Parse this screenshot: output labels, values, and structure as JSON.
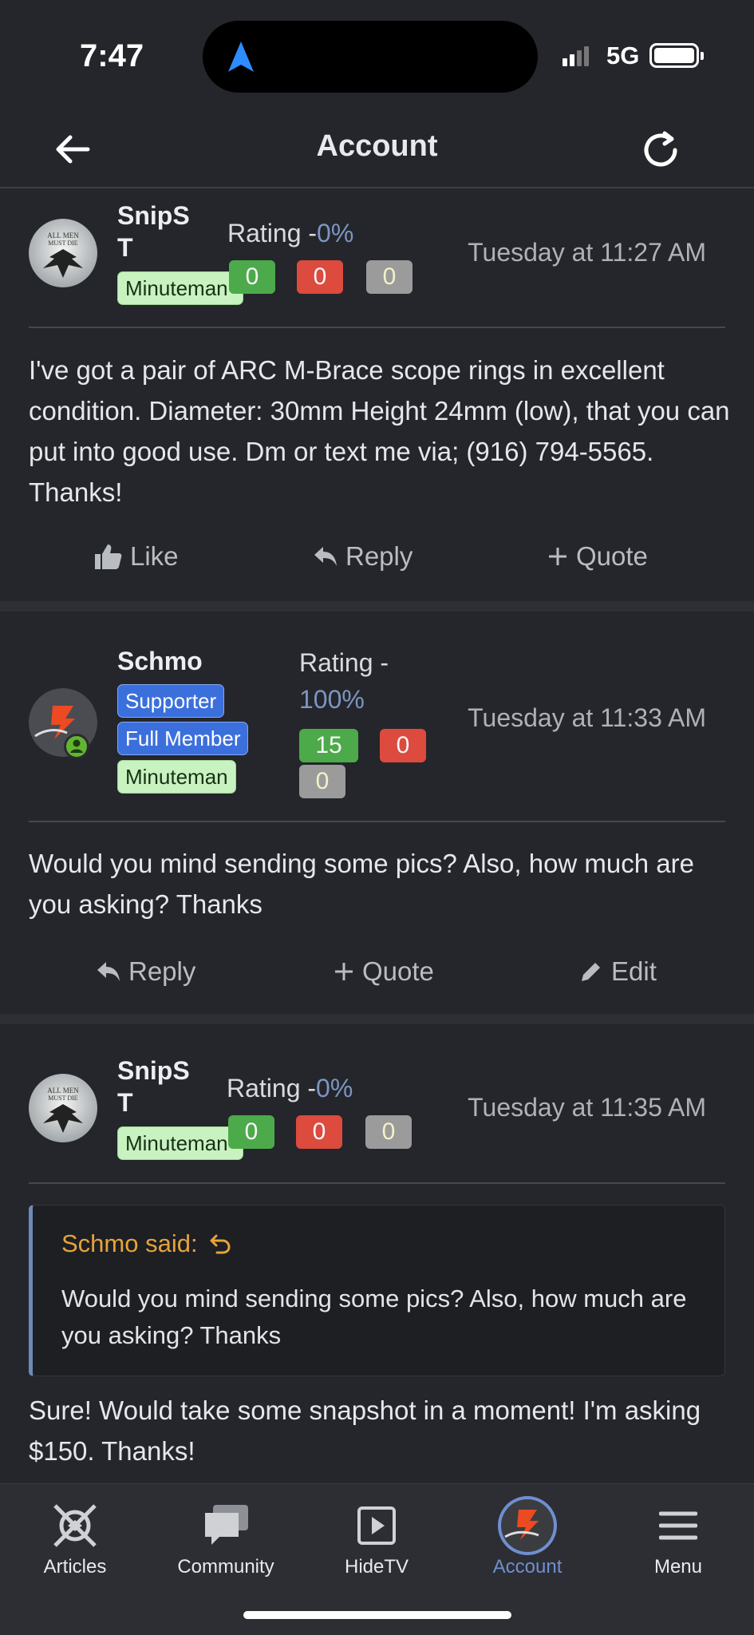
{
  "status_bar": {
    "time": "7:47",
    "network": "5G"
  },
  "header": {
    "title": "Account"
  },
  "posts": [
    {
      "username_line1": "SnipS",
      "username_line2": "T",
      "badges": [
        "Minuteman"
      ],
      "rating_label": "Rating -",
      "rating_pct": "0%",
      "likes": "0",
      "dislikes": "0",
      "neutral": "0",
      "date": "Tuesday at 11:27 AM",
      "body": "I've got a pair of ARC M-Brace scope rings in excellent condition. Diameter: 30mm Height 24mm (low), that you can put into good use. Dm or text me via; (916) 794-5565. Thanks!",
      "actions": [
        "Like",
        "Reply",
        "Quote"
      ]
    },
    {
      "username": "Schmo",
      "badges": [
        "Supporter",
        "Full Member",
        "Minuteman"
      ],
      "rating_label": "Rating -",
      "rating_pct": "100%",
      "likes": "15",
      "dislikes": "0",
      "neutral": "0",
      "date": "Tuesday at 11:33 AM",
      "body": "Would you mind sending some pics? Also, how much are you asking? Thanks",
      "actions": [
        "Reply",
        "Quote",
        "Edit"
      ]
    },
    {
      "username_line1": "SnipS",
      "username_line2": "T",
      "badges": [
        "Minuteman"
      ],
      "rating_label": "Rating -",
      "rating_pct": "0%",
      "likes": "0",
      "dislikes": "0",
      "neutral": "0",
      "date": "Tuesday at 11:35 AM",
      "quote_author": "Schmo said:",
      "quote_text": "Would you mind sending some pics? Also, how much are you asking? Thanks",
      "body": "Sure! Would take some snapshot in a moment! I'm asking $150. Thanks!"
    }
  ],
  "tabbar": {
    "items": [
      {
        "label": "Articles",
        "icon": "articles-icon"
      },
      {
        "label": "Community",
        "icon": "community-icon"
      },
      {
        "label": "HideTV",
        "icon": "video-icon"
      },
      {
        "label": "Account",
        "icon": "avatar-icon",
        "active": true
      },
      {
        "label": "Menu",
        "icon": "menu-icon"
      }
    ]
  },
  "colors": {
    "background": "#24262b",
    "rating_green": "#4caa4a",
    "rating_red": "#dc4b3e",
    "rating_gray": "#9b9b9b",
    "minuteman_badge": "#c8f2c0",
    "member_badge": "#3b6fdc",
    "quote_author": "#e7a33a",
    "active_tab": "#6f8fd0"
  }
}
